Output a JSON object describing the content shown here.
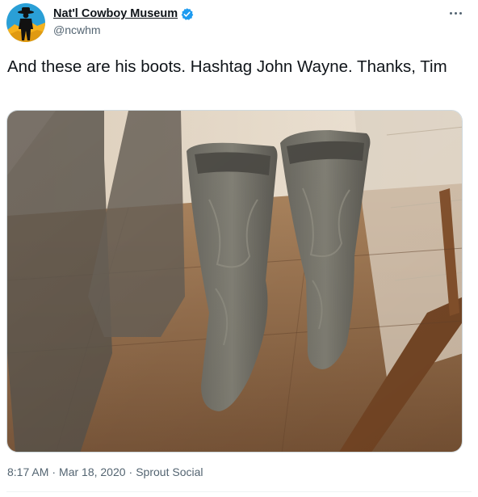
{
  "tweet": {
    "display_name": "Nat'l Cowboy Museum",
    "handle": "@ncwhm",
    "text": "And these are his boots. Hashtag John Wayne. Thanks, Tim",
    "time": "8:17 AM",
    "date": "Mar 18, 2020",
    "source": "Sprout Social",
    "separator": "·"
  },
  "icons": {
    "avatar": "cowboy-silhouette-avatar",
    "verified": "verified-badge-icon",
    "more": "more-options-icon"
  },
  "colors": {
    "verified": "#1d9bf0",
    "text_primary": "#0f1419",
    "text_secondary": "#536471",
    "avatar_sky": "#2a9fd6",
    "avatar_sun": "#f5b21e"
  },
  "media": {
    "subject": "photo of a pair of cowboy boots in a glass display case"
  }
}
